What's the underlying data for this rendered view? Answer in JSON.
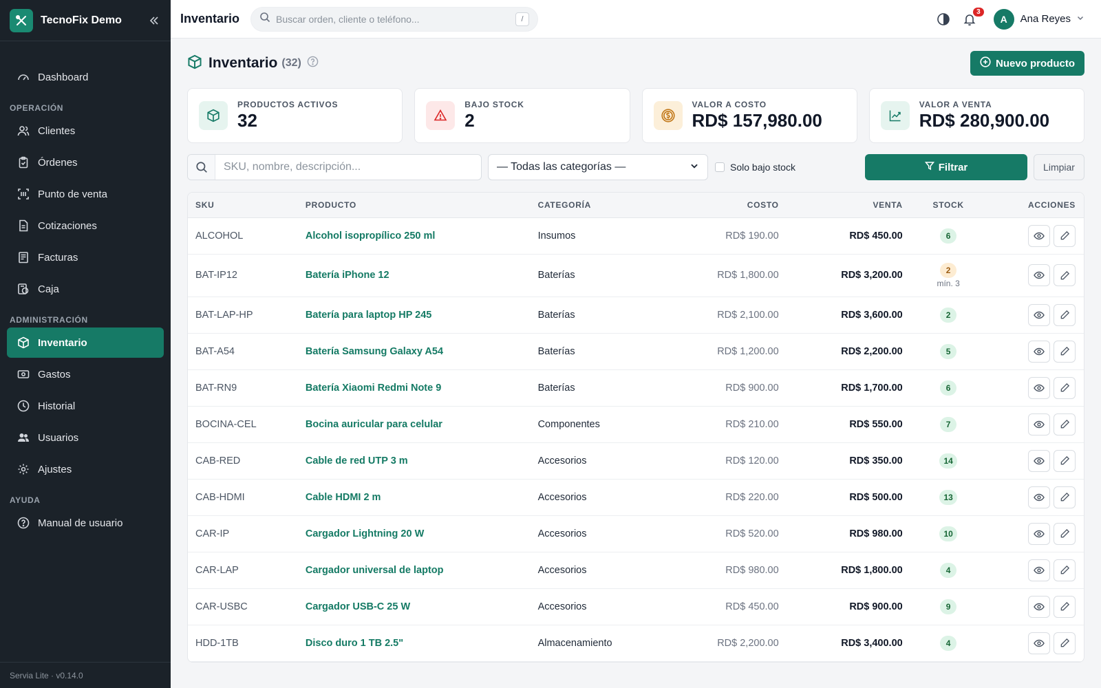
{
  "sidebar": {
    "brand": "TecnoFix Demo",
    "dashboard": "Dashboard",
    "sections": {
      "operacion": "OPERACIÓN",
      "administracion": "ADMINISTRACIÓN",
      "ayuda": "AYUDA"
    },
    "items": {
      "clientes": "Clientes",
      "ordenes": "Órdenes",
      "pos": "Punto de venta",
      "cotizaciones": "Cotizaciones",
      "facturas": "Facturas",
      "caja": "Caja",
      "inventario": "Inventario",
      "gastos": "Gastos",
      "historial": "Historial",
      "usuarios": "Usuarios",
      "ajustes": "Ajustes",
      "manual": "Manual de usuario"
    },
    "active": "Inventario",
    "version": "Servia Lite · v0.14.0"
  },
  "topbar": {
    "title": "Inventario",
    "search_placeholder": "Buscar orden, cliente o teléfono...",
    "search_shortcut": "/",
    "notifications": "3",
    "user_initial": "A",
    "user_name": "Ana Reyes"
  },
  "page": {
    "title": "Inventario",
    "count": "(32)",
    "new_button": "Nuevo producto"
  },
  "stats": [
    {
      "label": "PRODUCTOS ACTIVOS",
      "value": "32",
      "icon": "box-icon",
      "color": "#167a66"
    },
    {
      "label": "BAJO STOCK",
      "value": "2",
      "icon": "warning-icon",
      "color": "#dc2626"
    },
    {
      "label": "VALOR A COSTO",
      "value": "RD$ 157,980.00",
      "icon": "coin-icon",
      "color": "#c2791a"
    },
    {
      "label": "VALOR A VENTA",
      "value": "RD$ 280,900.00",
      "icon": "trend-up-icon",
      "color": "#167a66"
    }
  ],
  "filters": {
    "search_placeholder": "SKU, nombre, descripción...",
    "category_selected": "— Todas las categorías —",
    "low_stock_label": "Solo bajo stock",
    "low_stock_checked": false,
    "filter_button": "Filtrar",
    "clear_button": "Limpiar"
  },
  "table": {
    "headers": {
      "sku": "SKU",
      "product": "PRODUCTO",
      "category": "CATEGORÍA",
      "cost": "COSTO",
      "sale": "VENTA",
      "stock": "STOCK",
      "actions": "ACCIONES"
    },
    "rows": [
      {
        "sku": "ALCOHOL",
        "product": "Alcohol isopropílico 250 ml",
        "category": "Insumos",
        "cost": "RD$ 190.00",
        "sale": "RD$ 450.00",
        "stock": "6",
        "low": false,
        "min": ""
      },
      {
        "sku": "BAT-IP12",
        "product": "Batería iPhone 12",
        "category": "Baterías",
        "cost": "RD$ 1,800.00",
        "sale": "RD$ 3,200.00",
        "stock": "2",
        "low": true,
        "min": "mín. 3"
      },
      {
        "sku": "BAT-LAP-HP",
        "product": "Batería para laptop HP 245",
        "category": "Baterías",
        "cost": "RD$ 2,100.00",
        "sale": "RD$ 3,600.00",
        "stock": "2",
        "low": false,
        "min": ""
      },
      {
        "sku": "BAT-A54",
        "product": "Batería Samsung Galaxy A54",
        "category": "Baterías",
        "cost": "RD$ 1,200.00",
        "sale": "RD$ 2,200.00",
        "stock": "5",
        "low": false,
        "min": ""
      },
      {
        "sku": "BAT-RN9",
        "product": "Batería Xiaomi Redmi Note 9",
        "category": "Baterías",
        "cost": "RD$ 900.00",
        "sale": "RD$ 1,700.00",
        "stock": "6",
        "low": false,
        "min": ""
      },
      {
        "sku": "BOCINA-CEL",
        "product": "Bocina auricular para celular",
        "category": "Componentes",
        "cost": "RD$ 210.00",
        "sale": "RD$ 550.00",
        "stock": "7",
        "low": false,
        "min": ""
      },
      {
        "sku": "CAB-RED",
        "product": "Cable de red UTP 3 m",
        "category": "Accesorios",
        "cost": "RD$ 120.00",
        "sale": "RD$ 350.00",
        "stock": "14",
        "low": false,
        "min": ""
      },
      {
        "sku": "CAB-HDMI",
        "product": "Cable HDMI 2 m",
        "category": "Accesorios",
        "cost": "RD$ 220.00",
        "sale": "RD$ 500.00",
        "stock": "13",
        "low": false,
        "min": ""
      },
      {
        "sku": "CAR-IP",
        "product": "Cargador Lightning 20 W",
        "category": "Accesorios",
        "cost": "RD$ 520.00",
        "sale": "RD$ 980.00",
        "stock": "10",
        "low": false,
        "min": ""
      },
      {
        "sku": "CAR-LAP",
        "product": "Cargador universal de laptop",
        "category": "Accesorios",
        "cost": "RD$ 980.00",
        "sale": "RD$ 1,800.00",
        "stock": "4",
        "low": false,
        "min": ""
      },
      {
        "sku": "CAR-USBC",
        "product": "Cargador USB-C 25 W",
        "category": "Accesorios",
        "cost": "RD$ 450.00",
        "sale": "RD$ 900.00",
        "stock": "9",
        "low": false,
        "min": ""
      },
      {
        "sku": "HDD-1TB",
        "product": "Disco duro 1 TB 2.5\"",
        "category": "Almacenamiento",
        "cost": "RD$ 2,200.00",
        "sale": "RD$ 3,400.00",
        "stock": "4",
        "low": false,
        "min": ""
      }
    ]
  }
}
